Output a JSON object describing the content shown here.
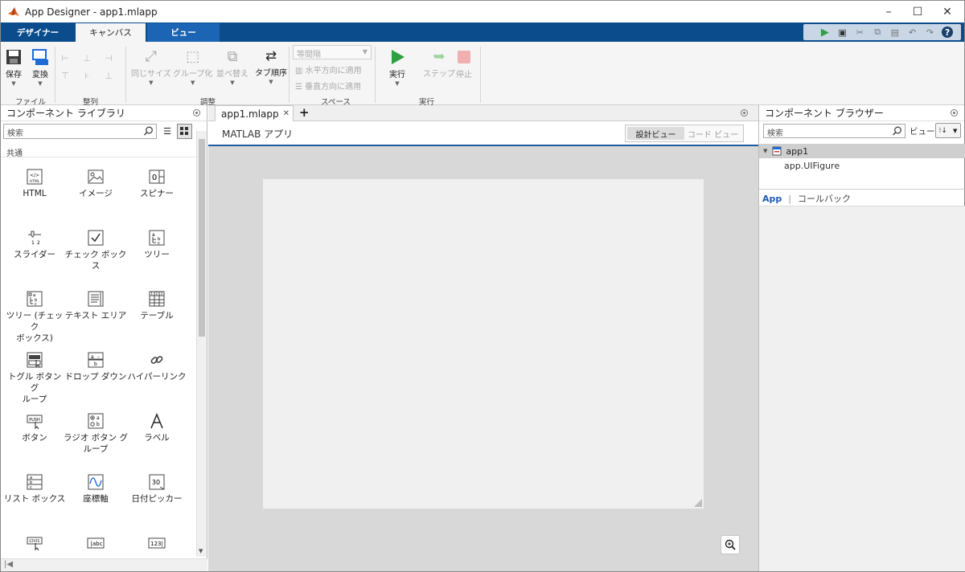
{
  "window": {
    "title": "App Designer - app1.mlapp"
  },
  "ribbon_tabs": [
    "デザイナー",
    "キャンバス",
    "ビュー"
  ],
  "ribbon": {
    "save": "保存",
    "convert": "変換",
    "file_group": "ファイル",
    "align_group": "整列",
    "same_size": "同じサイズ",
    "group": "グループ化",
    "arrange": "並べ替え",
    "tab_order": "タブ順序",
    "adjust_group": "調整",
    "spacing_select": "等間隔",
    "apply_horizontal": "水平方向に適用",
    "apply_vertical": "垂直方向に適用",
    "space_group": "スペース",
    "run": "実行",
    "step": "ステップ",
    "stop": "停止",
    "run_group": "実行"
  },
  "left_panel": {
    "title": "コンポーネント ライブラリ",
    "search_placeholder": "検索",
    "section": "共通",
    "components": [
      "HTML",
      "イメージ",
      "スピナー",
      "スライダー",
      "チェック ボックス",
      "ツリー",
      "ツリー (チェック\nボックス)",
      "テキスト エリア",
      "テーブル",
      "トグル ボタン グ\nループ",
      "ドロップ ダウン",
      "ハイパーリンク",
      "ボタン",
      "ラジオ ボタン グ\nループ",
      "ラベル",
      "リスト ボックス",
      "座標軸",
      "日付ピッカー"
    ]
  },
  "document": {
    "tab": "app1.mlapp",
    "app_title": "MATLAB アプリ",
    "design_view": "設計ビュー",
    "code_view": "コード ビュー"
  },
  "right_panel": {
    "title": "コンポーネント ブラウザー",
    "search_placeholder": "検索",
    "view_label": "ビュー:",
    "tree_root": "app1",
    "tree_child": "app.UIFigure",
    "tab_app": "App",
    "tab_callback": "コールバック"
  },
  "colors": {
    "ribbon_blue": "#0b4c8c",
    "run_green": "#2ea043",
    "accent_line": "#1e5aa0"
  }
}
